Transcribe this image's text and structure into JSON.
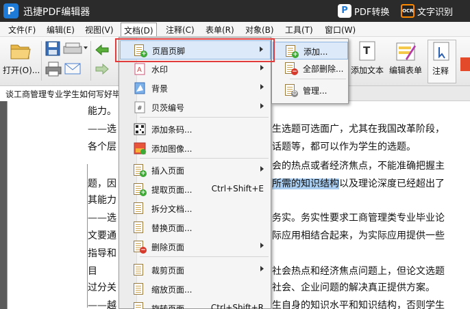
{
  "window": {
    "app_title": "迅捷PDF编辑器",
    "pdf_convert_label": "PDF转换",
    "ocr_label": "文字识别",
    "ocr_icon_text": "OCR"
  },
  "menubar": [
    "文件(F)",
    "编辑(E)",
    "视图(V)",
    "文档(D)",
    "注释(C)",
    "表单(R)",
    "对象(B)",
    "工具(T)",
    "窗口(W)"
  ],
  "toolbar": {
    "open_label": "打开(O)...",
    "add_text_label": "添加文本",
    "edit_form_label": "编辑表单",
    "annotate_label": "注释"
  },
  "document_tab": "谈工商管理专业学生如何写好毕",
  "document_menu": {
    "items": [
      {
        "label": "页眉页脚",
        "shortcut": "",
        "submenu": true
      },
      {
        "label": "水印",
        "shortcut": "",
        "submenu": true
      },
      {
        "label": "背景",
        "shortcut": "",
        "submenu": true
      },
      {
        "label": "贝茨编号",
        "shortcut": "",
        "submenu": true
      },
      {
        "label": "添加条码...",
        "shortcut": "",
        "submenu": false
      },
      {
        "label": "添加图像...",
        "shortcut": "",
        "submenu": false
      },
      {
        "label": "插入页面",
        "shortcut": "",
        "submenu": true
      },
      {
        "label": "提取页面...",
        "shortcut": "Ctrl+Shift+E",
        "submenu": false
      },
      {
        "label": "拆分文档...",
        "shortcut": "",
        "submenu": false
      },
      {
        "label": "替换页面...",
        "shortcut": "",
        "submenu": false
      },
      {
        "label": "删除页面",
        "shortcut": "",
        "submenu": true
      },
      {
        "label": "裁剪页面",
        "shortcut": "",
        "submenu": true
      },
      {
        "label": "缩放页面...",
        "shortcut": "",
        "submenu": false
      },
      {
        "label": "旋转页面...",
        "shortcut": "Ctrl+Shift+R",
        "submenu": false
      }
    ]
  },
  "header_footer_submenu": {
    "items": [
      "添加...",
      "全部删除...",
      "管理..."
    ]
  },
  "document_text": {
    "lines": [
      {
        "pre": "能力。",
        "hl": "",
        "post": ""
      },
      {
        "pre": "——选",
        "hl": "",
        "post": ""
      },
      {
        "pre": "各个层",
        "hl": "",
        "post": ""
      },
      {
        "pre": "    ",
        "hl": "",
        "post": ""
      },
      {
        "pre": "题，因",
        "hl": "",
        "post": ""
      },
      {
        "pre": "其能力",
        "hl": "",
        "post": ""
      },
      {
        "pre": "——选",
        "hl": "",
        "post": ""
      },
      {
        "pre": "文要通",
        "hl": "",
        "post": ""
      },
      {
        "pre": "指导和",
        "hl": "",
        "post": ""
      },
      {
        "pre": "    目",
        "hl": "",
        "post": ""
      },
      {
        "pre": "过分关",
        "hl": "",
        "post": ""
      },
      {
        "pre": "——越",
        "hl": "",
        "post": ""
      }
    ],
    "right_lines": [
      "",
      "生选题可选面广，尤其在我国改革阶段，",
      "话题等，都可以作为学生的选题。",
      "会的热点或者经济焦点，不能准确把握主",
      "所需的知识结构|以及理论深度已经超出了",
      "",
      "务实。务实性要求工商管理类专业毕业论",
      "际应用相结合起来，为实际应用提供一些",
      "",
      "社会热点和经济焦点问题上，但论文选题",
      "社会、企业问题的解决真正提供方案。",
      "生自身的知识水平和知识结构，否则学生"
    ]
  }
}
